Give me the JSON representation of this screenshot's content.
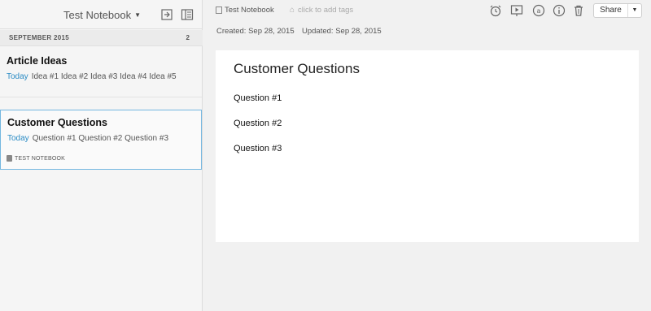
{
  "sidebar": {
    "notebook_title": "Test Notebook",
    "section_label": "SEPTEMBER 2015",
    "section_count": "2",
    "notes": [
      {
        "title": "Article Ideas",
        "date": "Today",
        "snippet": "Idea #1 Idea #2 Idea #3 Idea #4 Idea #5"
      },
      {
        "title": "Customer Questions",
        "date": "Today",
        "snippet": "Question #1 Question #2 Question #3",
        "notebook_tag": "TEST NOTEBOOK"
      }
    ]
  },
  "toolbar": {
    "notebook": "Test Notebook",
    "tags_placeholder": "click to add tags",
    "share_label": "Share",
    "icons": [
      "alarm-clock-icon",
      "presentation-icon",
      "at-sign-icon",
      "info-icon",
      "trash-icon"
    ]
  },
  "meta": {
    "created": "Created: Sep 28, 2015",
    "updated": "Updated: Sep 28, 2015"
  },
  "note": {
    "title": "Customer Questions",
    "lines": [
      "Question #1",
      "Question #2",
      "Question #3"
    ]
  },
  "colors": {
    "accent": "#2a8bc4",
    "selection_border": "#74b7e0"
  }
}
